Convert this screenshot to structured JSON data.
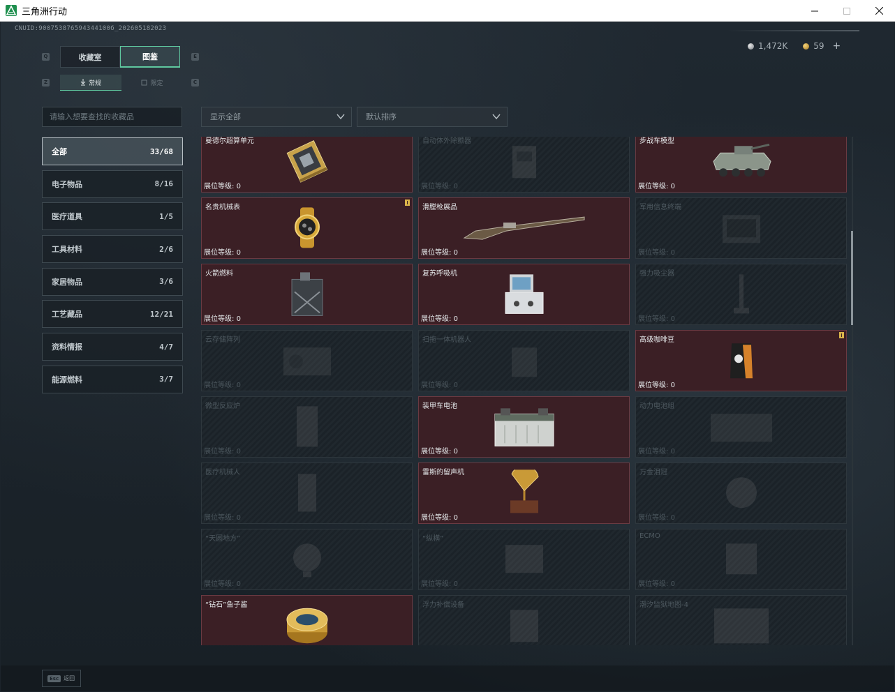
{
  "window": {
    "title": "三角洲行动"
  },
  "header": {
    "uid": "CNUID:900753876594344100б_202605182023",
    "silver": "1,472K",
    "gold": "59",
    "plus": "+"
  },
  "tabs": [
    {
      "label": "收藏室"
    },
    {
      "label": "图鉴"
    }
  ],
  "subtabs": [
    {
      "label": "常规"
    },
    {
      "label": "限定"
    }
  ],
  "keys": {
    "q": "Q",
    "e": "E",
    "z": "Z",
    "c": "C"
  },
  "search": {
    "placeholder": "请输入想要查找的收藏品"
  },
  "filters": {
    "display": "显示全部",
    "sort": "默认排序"
  },
  "categories": [
    {
      "label": "全部",
      "count": "33/68"
    },
    {
      "label": "电子物品",
      "count": "8/16"
    },
    {
      "label": "医疗道具",
      "count": "1/5"
    },
    {
      "label": "工具材料",
      "count": "2/6"
    },
    {
      "label": "家居物品",
      "count": "3/6"
    },
    {
      "label": "工艺藏品",
      "count": "12/21"
    },
    {
      "label": "资料情报",
      "count": "4/7"
    },
    {
      "label": "能源燃料",
      "count": "3/7"
    }
  ],
  "level_prefix": "展位等级:",
  "items": [
    {
      "name": "曼德尔超算单元",
      "level": "0",
      "owned": true,
      "icon": "gpu-icon"
    },
    {
      "name": "自动体外除颤器",
      "level": "0",
      "owned": false,
      "icon": "defibrillator-icon"
    },
    {
      "name": "步战车模型",
      "level": "0",
      "owned": true,
      "icon": "ifv-model-icon"
    },
    {
      "name": "名贵机械表",
      "level": "0",
      "owned": true,
      "icon": "watch-icon",
      "flag": true
    },
    {
      "name": "滑膛枪展品",
      "level": "0",
      "owned": true,
      "icon": "musket-icon"
    },
    {
      "name": "军用信息终端",
      "level": "0",
      "owned": false,
      "icon": "terminal-icon"
    },
    {
      "name": "火箭燃料",
      "level": "0",
      "owned": true,
      "icon": "fuel-can-icon"
    },
    {
      "name": "复苏呼吸机",
      "level": "0",
      "owned": true,
      "icon": "ventilator-icon"
    },
    {
      "name": "强力吸尘器",
      "level": "0",
      "owned": false,
      "icon": "vacuum-icon"
    },
    {
      "name": "云存储阵列",
      "level": "0",
      "owned": false,
      "icon": "storage-array-icon"
    },
    {
      "name": "扫拖一体机器人",
      "level": "0",
      "owned": false,
      "icon": "robot-icon"
    },
    {
      "name": "高级咖啡豆",
      "level": "0",
      "owned": true,
      "icon": "coffee-bag-icon",
      "flag": true
    },
    {
      "name": "微型反应炉",
      "level": "0",
      "owned": false,
      "icon": "reactor-icon"
    },
    {
      "name": "装甲车电池",
      "level": "0",
      "owned": true,
      "icon": "battery-icon"
    },
    {
      "name": "动力电池组",
      "level": "0",
      "owned": false,
      "icon": "battery-pack-icon"
    },
    {
      "name": "医疗机械人",
      "level": "0",
      "owned": false,
      "icon": "medical-robot-icon"
    },
    {
      "name": "雷斯的留声机",
      "level": "0",
      "owned": true,
      "icon": "gramophone-icon"
    },
    {
      "name": "万金泪冠",
      "level": "0",
      "owned": false,
      "icon": "crown-icon"
    },
    {
      "name": "“天圆地方”",
      "level": "0",
      "owned": false,
      "icon": "globe-icon"
    },
    {
      "name": "“纵横”",
      "level": "0",
      "owned": false,
      "icon": "chessboard-icon"
    },
    {
      "name": "ECMO",
      "level": "0",
      "owned": false,
      "icon": "ecmo-icon"
    },
    {
      "name": "“钻石”鱼子酱",
      "level": "0",
      "owned": true,
      "icon": "caviar-icon"
    },
    {
      "name": "浮力补偿设备",
      "level": "0",
      "owned": false,
      "icon": "bcd-icon"
    },
    {
      "name": "潮汐监狱地图-4",
      "level": "0",
      "owned": false,
      "icon": "map-icon"
    }
  ],
  "bottom": {
    "esc": "Esc",
    "back": "返回"
  }
}
